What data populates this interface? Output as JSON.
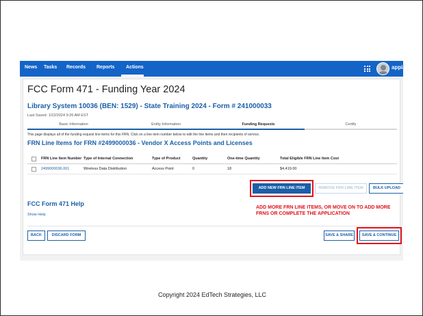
{
  "nav": {
    "items": [
      "News",
      "Tasks",
      "Records",
      "Reports",
      "Actions"
    ],
    "active": "Actions",
    "brand": "appian",
    "icons": {
      "app_launcher": "grid-icon",
      "user": "avatar-icon"
    },
    "color": "#1464c8"
  },
  "page": {
    "title": "FCC Form 471 - Funding Year 2024",
    "subtitle": "Library System 10036 (BEN: 1529) - State Training 2024 - Form # 241000033",
    "last_saved": "Last Saved: 1/22/2024 9:26 AM EST"
  },
  "steps": {
    "items": [
      "Basic Information",
      "Entity Information",
      "Funding Requests",
      "Certify"
    ],
    "current": "Funding Requests"
  },
  "description": "This page displays all of the funding request line items for this FRN. Click on a line item number below to edit the line items and their recipients of service.",
  "section_title": "FRN Line Items for FRN #2499000036 - Vendor X Access Points and Licenses",
  "table": {
    "headers": [
      "FRN Line Item Number",
      "Type of Internal Connection",
      "Type of Product",
      "Quantity",
      "One-time Quantity",
      "Total Eligible FRN Line Item Cost"
    ],
    "rows": [
      [
        "2499000036.001",
        "Wireless Data Distribution",
        "Access Point",
        "0",
        "18",
        "$4,419.00"
      ]
    ]
  },
  "buttons": {
    "add_line_item": "ADD NEW FRN LINE ITEM",
    "remove_line_item": "REMOVE FRN LINE ITEM",
    "bulk_upload": "BULK UPLOAD",
    "back": "BACK",
    "discard": "DISCARD FORM",
    "save_share": "SAVE & SHARE",
    "save_continue": "SAVE & CONTINUE"
  },
  "help": {
    "title": "FCC Form 471 Help",
    "show_help": "Show Help"
  },
  "annotation": "ADD MORE FRN LINE ITEMS, OR MOVE ON TO ADD MORE FRNS OR COMPLETE THE APPLICATION",
  "copyright": "Copyright 2024 EdTech Strategies, LLC",
  "colors": {
    "accent": "#1b5fa8",
    "highlight": "#e0121b"
  }
}
